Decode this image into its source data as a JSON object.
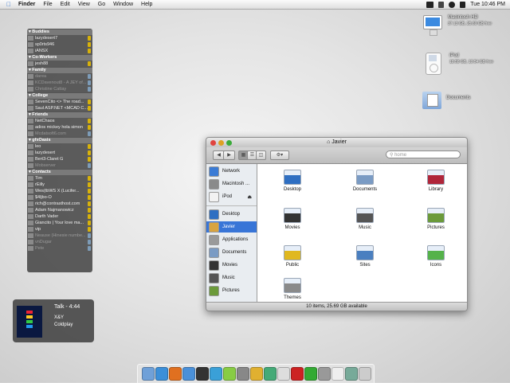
{
  "menubar": {
    "items": [
      "Finder",
      "File",
      "Edit",
      "View",
      "Go",
      "Window",
      "Help"
    ],
    "clock": "Tue 10:46 PM"
  },
  "desktop_icons": [
    {
      "name": "Macintosh HD",
      "detail": "37.13 GB, 25.69 GB free"
    },
    {
      "name": "iPod",
      "detail": "18.58 GB, 10.54 GB free"
    },
    {
      "name": "Documents",
      "detail": ""
    }
  ],
  "buddy_list": {
    "groups": [
      {
        "name": "Buddies",
        "buddies": [
          {
            "name": "lazydesert7",
            "idle": false
          },
          {
            "name": "sp0rts946",
            "idle": false
          },
          {
            "name": "iANSX",
            "idle": false
          }
        ]
      },
      {
        "name": "Co-Workers",
        "buddies": [
          {
            "name": "jesh88",
            "idle": false
          }
        ]
      },
      {
        "name": "Family",
        "buddies": [
          {
            "name": "darea",
            "idle": true
          },
          {
            "name": "KCDavenout8 - A JEY of...",
            "idle": true
          },
          {
            "name": "Christine Cattay",
            "idle": true
          }
        ]
      },
      {
        "name": "College",
        "buddies": [
          {
            "name": "SevenCito <> The road...",
            "idle": false
          },
          {
            "name": "Saul ASP.NET <MCAD C...",
            "idle": false
          }
        ]
      },
      {
        "name": "Friends",
        "buddies": [
          {
            "name": "NetChaos",
            "idle": false
          },
          {
            "name": "adios mickey hola simon",
            "idle": false
          },
          {
            "name": "Mcdatsoft6.com",
            "idle": true
          }
        ]
      },
      {
        "name": "gfxOasis",
        "buddies": [
          {
            "name": "leo",
            "idle": false
          },
          {
            "name": "lazydesert",
            "idle": false
          },
          {
            "name": "Bert3-Claret G",
            "idle": false
          },
          {
            "name": "Mobserver",
            "idle": true
          }
        ]
      },
      {
        "name": "Contacts",
        "buddies": [
          {
            "name": "Tim",
            "idle": false
          },
          {
            "name": "rEilly",
            "idle": false
          },
          {
            "name": "Wes(tbWS X (Lucifer...",
            "idle": false
          },
          {
            "name": "$4ljbo-O",
            "idle": false
          },
          {
            "name": "rich@contrasthost.com",
            "idle": false
          },
          {
            "name": "Adam Najmanowicz",
            "idle": false
          },
          {
            "name": "Darth Vader",
            "idle": false
          },
          {
            "name": "Giancito | Your love ma...",
            "idle": false
          },
          {
            "name": "vip",
            "idle": false
          },
          {
            "name": "Neause (Hinesie numbe...",
            "idle": true
          },
          {
            "name": "vnDugar",
            "idle": true
          },
          {
            "name": "Pete",
            "idle": true
          }
        ]
      }
    ]
  },
  "now_playing": {
    "track": "Talk - 4:44",
    "album": "X&Y",
    "artist": "Coldplay"
  },
  "finder": {
    "title": "Javier",
    "search_placeholder": "home",
    "action_label": "⚙▾",
    "sidebar": [
      {
        "label": "Network",
        "icon": "globe-icon",
        "selected": false
      },
      {
        "label": "Macintosh ...",
        "icon": "hard-drive-icon",
        "selected": false
      },
      {
        "label": "iPod",
        "icon": "ipod-icon",
        "selected": false
      },
      {
        "label": "Desktop",
        "icon": "desktop-icon",
        "selected": false
      },
      {
        "label": "Javier",
        "icon": "home-icon",
        "selected": true
      },
      {
        "label": "Applications",
        "icon": "applications-icon",
        "selected": false
      },
      {
        "label": "Documents",
        "icon": "documents-icon",
        "selected": false
      },
      {
        "label": "Movies",
        "icon": "movies-icon",
        "selected": false
      },
      {
        "label": "Music",
        "icon": "music-icon",
        "selected": false
      },
      {
        "label": "Pictures",
        "icon": "pictures-icon",
        "selected": false
      }
    ],
    "items": [
      {
        "label": "Desktop",
        "color": "#2f6fc2"
      },
      {
        "label": "Documents",
        "color": "#7a9bc4"
      },
      {
        "label": "Library",
        "color": "#b0263a"
      },
      {
        "label": "Movies",
        "color": "#333333"
      },
      {
        "label": "Music",
        "color": "#555555"
      },
      {
        "label": "Pictures",
        "color": "#6b9a3a"
      },
      {
        "label": "Public",
        "color": "#e0b81f"
      },
      {
        "label": "Sites",
        "color": "#4a7fc0"
      },
      {
        "label": "Icons",
        "color": "#55b24a"
      },
      {
        "label": "Themes",
        "color": "#8a8a8a"
      }
    ],
    "status": "10 items, 25.69 GB available"
  },
  "dock_apps": [
    "finder-icon",
    "safari-icon",
    "firefox-icon",
    "mail-icon",
    "dashboard-icon",
    "ichat-icon",
    "itunes-icon",
    "system-preferences-icon",
    "pencil-icon",
    "iphoto-icon",
    "adium-icon",
    "flash-icon",
    "music-icon",
    "disk-utility-icon",
    "calendar-icon",
    "preview-icon",
    "trash-icon"
  ]
}
